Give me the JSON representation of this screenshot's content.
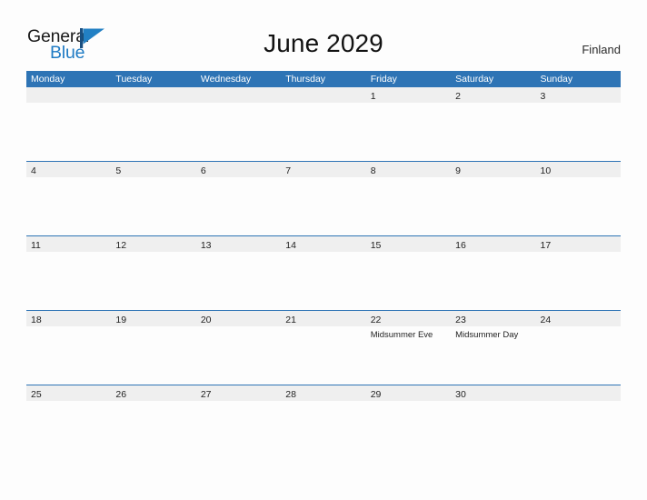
{
  "brand": {
    "name_part1": "General",
    "name_part2": "Blue",
    "flag_icon": "blue-triangle-flag-icon",
    "accent_color": "#1f7bc4"
  },
  "header": {
    "title": "June 2029",
    "country": "Finland"
  },
  "colors": {
    "header_blue": "#2e74b5",
    "day_band_gray": "#efefef",
    "page_background": "#fdfdfd",
    "text": "#1f1f1f"
  },
  "calendar": {
    "weekdays": [
      "Monday",
      "Tuesday",
      "Wednesday",
      "Thursday",
      "Friday",
      "Saturday",
      "Sunday"
    ],
    "weeks": [
      [
        {
          "date": "",
          "events": []
        },
        {
          "date": "",
          "events": []
        },
        {
          "date": "",
          "events": []
        },
        {
          "date": "",
          "events": []
        },
        {
          "date": "1",
          "events": []
        },
        {
          "date": "2",
          "events": []
        },
        {
          "date": "3",
          "events": []
        }
      ],
      [
        {
          "date": "4",
          "events": []
        },
        {
          "date": "5",
          "events": []
        },
        {
          "date": "6",
          "events": []
        },
        {
          "date": "7",
          "events": []
        },
        {
          "date": "8",
          "events": []
        },
        {
          "date": "9",
          "events": []
        },
        {
          "date": "10",
          "events": []
        }
      ],
      [
        {
          "date": "11",
          "events": []
        },
        {
          "date": "12",
          "events": []
        },
        {
          "date": "13",
          "events": []
        },
        {
          "date": "14",
          "events": []
        },
        {
          "date": "15",
          "events": []
        },
        {
          "date": "16",
          "events": []
        },
        {
          "date": "17",
          "events": []
        }
      ],
      [
        {
          "date": "18",
          "events": []
        },
        {
          "date": "19",
          "events": []
        },
        {
          "date": "20",
          "events": []
        },
        {
          "date": "21",
          "events": []
        },
        {
          "date": "22",
          "events": [
            "Midsummer Eve"
          ]
        },
        {
          "date": "23",
          "events": [
            "Midsummer Day"
          ]
        },
        {
          "date": "24",
          "events": []
        }
      ],
      [
        {
          "date": "25",
          "events": []
        },
        {
          "date": "26",
          "events": []
        },
        {
          "date": "27",
          "events": []
        },
        {
          "date": "28",
          "events": []
        },
        {
          "date": "29",
          "events": []
        },
        {
          "date": "30",
          "events": []
        },
        {
          "date": "",
          "events": []
        }
      ]
    ]
  }
}
